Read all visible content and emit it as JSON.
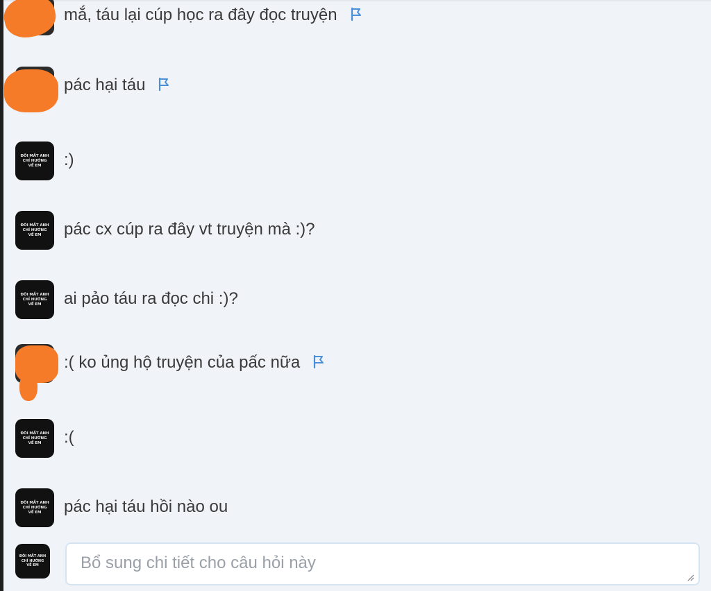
{
  "comments": [
    {
      "text": "mắ, táu lại cúp học ra đây đọc truyện",
      "flag": true,
      "avatar": "masked"
    },
    {
      "text": "pác hại táu",
      "flag": true,
      "avatar": "masked"
    },
    {
      "text": ":)",
      "flag": false,
      "avatar": "book"
    },
    {
      "text": "pác cx cúp ra đây vt truyện mà :)?",
      "flag": false,
      "avatar": "book"
    },
    {
      "text": "ai pảo táu ra đọc chi :)?",
      "flag": false,
      "avatar": "book"
    },
    {
      "text": ":( ko ủng hộ truyện của pấc nữa",
      "flag": true,
      "avatar": "masked"
    },
    {
      "text": ":(",
      "flag": false,
      "avatar": "book"
    },
    {
      "text": "pác hại táu hồi nào ou",
      "flag": false,
      "avatar": "book"
    }
  ],
  "avatar_book": {
    "line1": "ĐÔI MẮT ANH",
    "line2": "CHỈ HƯỚNG",
    "line3": "VỀ EM"
  },
  "reply": {
    "placeholder": "Bổ sung chi tiết cho câu hỏi này",
    "value": ""
  },
  "icons": {
    "flag": "flag-icon",
    "resize": "resize-grip-icon"
  },
  "colors": {
    "background": "#f0f3f8",
    "flag": "#4a90d9",
    "mask": "#f57b29",
    "input_border": "#d6e3f1"
  }
}
